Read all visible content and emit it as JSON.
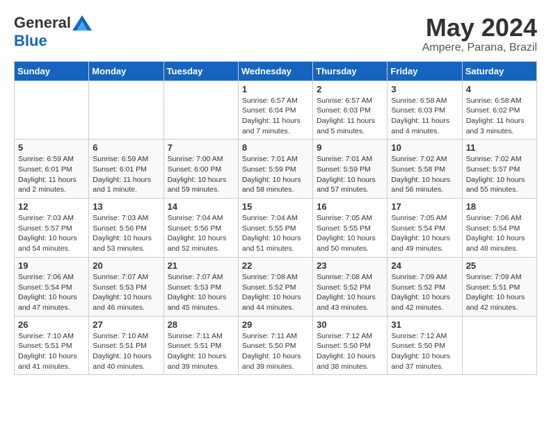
{
  "logo": {
    "general": "General",
    "blue": "Blue"
  },
  "header": {
    "title": "May 2024",
    "subtitle": "Ampere, Parana, Brazil"
  },
  "weekdays": [
    "Sunday",
    "Monday",
    "Tuesday",
    "Wednesday",
    "Thursday",
    "Friday",
    "Saturday"
  ],
  "weeks": [
    [
      {
        "day": "",
        "info": ""
      },
      {
        "day": "",
        "info": ""
      },
      {
        "day": "",
        "info": ""
      },
      {
        "day": "1",
        "info": "Sunrise: 6:57 AM\nSunset: 6:04 PM\nDaylight: 11 hours\nand 7 minutes."
      },
      {
        "day": "2",
        "info": "Sunrise: 6:57 AM\nSunset: 6:03 PM\nDaylight: 11 hours\nand 5 minutes."
      },
      {
        "day": "3",
        "info": "Sunrise: 6:58 AM\nSunset: 6:03 PM\nDaylight: 11 hours\nand 4 minutes."
      },
      {
        "day": "4",
        "info": "Sunrise: 6:58 AM\nSunset: 6:02 PM\nDaylight: 11 hours\nand 3 minutes."
      }
    ],
    [
      {
        "day": "5",
        "info": "Sunrise: 6:59 AM\nSunset: 6:01 PM\nDaylight: 11 hours\nand 2 minutes."
      },
      {
        "day": "6",
        "info": "Sunrise: 6:59 AM\nSunset: 6:01 PM\nDaylight: 11 hours\nand 1 minute."
      },
      {
        "day": "7",
        "info": "Sunrise: 7:00 AM\nSunset: 6:00 PM\nDaylight: 10 hours\nand 59 minutes."
      },
      {
        "day": "8",
        "info": "Sunrise: 7:01 AM\nSunset: 5:59 PM\nDaylight: 10 hours\nand 58 minutes."
      },
      {
        "day": "9",
        "info": "Sunrise: 7:01 AM\nSunset: 5:59 PM\nDaylight: 10 hours\nand 57 minutes."
      },
      {
        "day": "10",
        "info": "Sunrise: 7:02 AM\nSunset: 5:58 PM\nDaylight: 10 hours\nand 56 minutes."
      },
      {
        "day": "11",
        "info": "Sunrise: 7:02 AM\nSunset: 5:57 PM\nDaylight: 10 hours\nand 55 minutes."
      }
    ],
    [
      {
        "day": "12",
        "info": "Sunrise: 7:03 AM\nSunset: 5:57 PM\nDaylight: 10 hours\nand 54 minutes."
      },
      {
        "day": "13",
        "info": "Sunrise: 7:03 AM\nSunset: 5:56 PM\nDaylight: 10 hours\nand 53 minutes."
      },
      {
        "day": "14",
        "info": "Sunrise: 7:04 AM\nSunset: 5:56 PM\nDaylight: 10 hours\nand 52 minutes."
      },
      {
        "day": "15",
        "info": "Sunrise: 7:04 AM\nSunset: 5:55 PM\nDaylight: 10 hours\nand 51 minutes."
      },
      {
        "day": "16",
        "info": "Sunrise: 7:05 AM\nSunset: 5:55 PM\nDaylight: 10 hours\nand 50 minutes."
      },
      {
        "day": "17",
        "info": "Sunrise: 7:05 AM\nSunset: 5:54 PM\nDaylight: 10 hours\nand 49 minutes."
      },
      {
        "day": "18",
        "info": "Sunrise: 7:06 AM\nSunset: 5:54 PM\nDaylight: 10 hours\nand 48 minutes."
      }
    ],
    [
      {
        "day": "19",
        "info": "Sunrise: 7:06 AM\nSunset: 5:54 PM\nDaylight: 10 hours\nand 47 minutes."
      },
      {
        "day": "20",
        "info": "Sunrise: 7:07 AM\nSunset: 5:53 PM\nDaylight: 10 hours\nand 46 minutes."
      },
      {
        "day": "21",
        "info": "Sunrise: 7:07 AM\nSunset: 5:53 PM\nDaylight: 10 hours\nand 45 minutes."
      },
      {
        "day": "22",
        "info": "Sunrise: 7:08 AM\nSunset: 5:52 PM\nDaylight: 10 hours\nand 44 minutes."
      },
      {
        "day": "23",
        "info": "Sunrise: 7:08 AM\nSunset: 5:52 PM\nDaylight: 10 hours\nand 43 minutes."
      },
      {
        "day": "24",
        "info": "Sunrise: 7:09 AM\nSunset: 5:52 PM\nDaylight: 10 hours\nand 42 minutes."
      },
      {
        "day": "25",
        "info": "Sunrise: 7:09 AM\nSunset: 5:51 PM\nDaylight: 10 hours\nand 42 minutes."
      }
    ],
    [
      {
        "day": "26",
        "info": "Sunrise: 7:10 AM\nSunset: 5:51 PM\nDaylight: 10 hours\nand 41 minutes."
      },
      {
        "day": "27",
        "info": "Sunrise: 7:10 AM\nSunset: 5:51 PM\nDaylight: 10 hours\nand 40 minutes."
      },
      {
        "day": "28",
        "info": "Sunrise: 7:11 AM\nSunset: 5:51 PM\nDaylight: 10 hours\nand 39 minutes."
      },
      {
        "day": "29",
        "info": "Sunrise: 7:11 AM\nSunset: 5:50 PM\nDaylight: 10 hours\nand 39 minutes."
      },
      {
        "day": "30",
        "info": "Sunrise: 7:12 AM\nSunset: 5:50 PM\nDaylight: 10 hours\nand 38 minutes."
      },
      {
        "day": "31",
        "info": "Sunrise: 7:12 AM\nSunset: 5:50 PM\nDaylight: 10 hours\nand 37 minutes."
      },
      {
        "day": "",
        "info": ""
      }
    ]
  ]
}
